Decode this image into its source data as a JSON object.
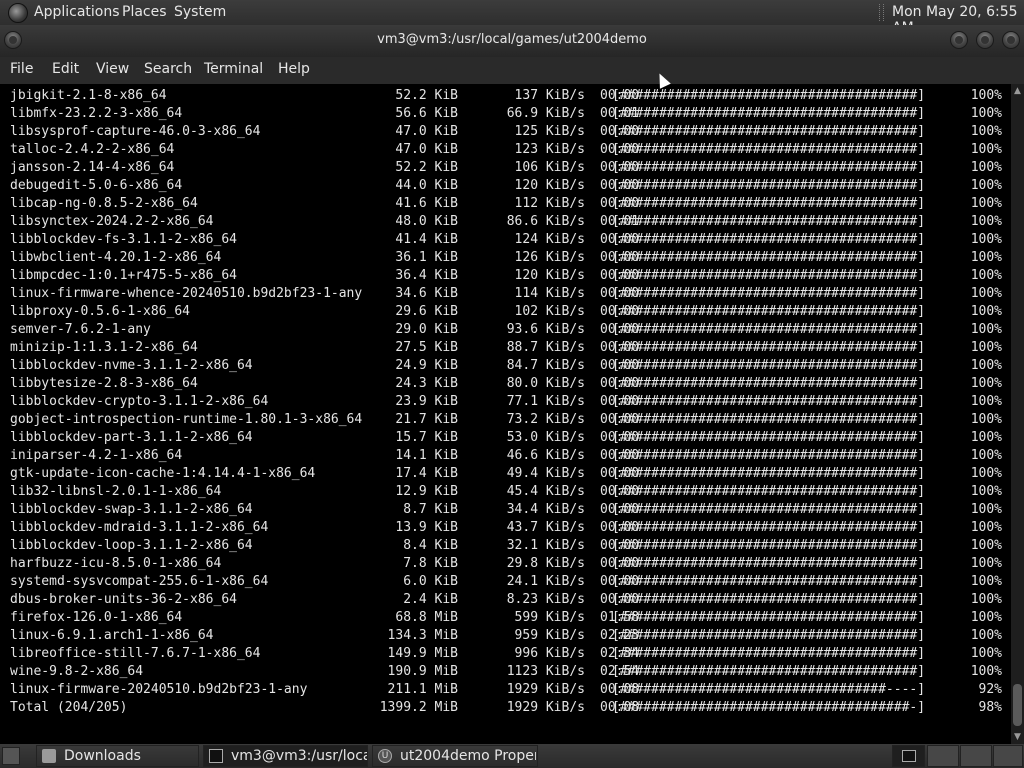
{
  "top_panel": {
    "menus": [
      "Applications",
      "Places",
      "System"
    ],
    "clock": "Mon May 20,  6:55 AM"
  },
  "window": {
    "title": "vm3@vm3:/usr/local/games/ut2004demo"
  },
  "menubar": [
    "File",
    "Edit",
    "View",
    "Search",
    "Terminal",
    "Help"
  ],
  "terminal": {
    "lines": [
      {
        "name": "jbigkit-2.1-8-x86_64",
        "size": "52.2 KiB",
        "rate": "137 KiB/s",
        "eta": "00:00",
        "bar": "[######################################]",
        "pct": "100%"
      },
      {
        "name": "libmfx-23.2.2-3-x86_64",
        "size": "56.6 KiB",
        "rate": "66.9 KiB/s",
        "eta": "00:01",
        "bar": "[######################################]",
        "pct": "100%"
      },
      {
        "name": "libsysprof-capture-46.0-3-x86_64",
        "size": "47.0 KiB",
        "rate": "125 KiB/s",
        "eta": "00:00",
        "bar": "[######################################]",
        "pct": "100%"
      },
      {
        "name": "talloc-2.4.2-2-x86_64",
        "size": "47.0 KiB",
        "rate": "123 KiB/s",
        "eta": "00:00",
        "bar": "[######################################]",
        "pct": "100%"
      },
      {
        "name": "jansson-2.14-4-x86_64",
        "size": "52.2 KiB",
        "rate": "106 KiB/s",
        "eta": "00:00",
        "bar": "[######################################]",
        "pct": "100%"
      },
      {
        "name": "debugedit-5.0-6-x86_64",
        "size": "44.0 KiB",
        "rate": "120 KiB/s",
        "eta": "00:00",
        "bar": "[######################################]",
        "pct": "100%"
      },
      {
        "name": "libcap-ng-0.8.5-2-x86_64",
        "size": "41.6 KiB",
        "rate": "112 KiB/s",
        "eta": "00:00",
        "bar": "[######################################]",
        "pct": "100%"
      },
      {
        "name": "libsynctex-2024.2-2-x86_64",
        "size": "48.0 KiB",
        "rate": "86.6 KiB/s",
        "eta": "00:01",
        "bar": "[######################################]",
        "pct": "100%"
      },
      {
        "name": "libblockdev-fs-3.1.1-2-x86_64",
        "size": "41.4 KiB",
        "rate": "124 KiB/s",
        "eta": "00:00",
        "bar": "[######################################]",
        "pct": "100%"
      },
      {
        "name": "libwbclient-4.20.1-2-x86_64",
        "size": "36.1 KiB",
        "rate": "126 KiB/s",
        "eta": "00:00",
        "bar": "[######################################]",
        "pct": "100%"
      },
      {
        "name": "libmpcdec-1:0.1+r475-5-x86_64",
        "size": "36.4 KiB",
        "rate": "120 KiB/s",
        "eta": "00:00",
        "bar": "[######################################]",
        "pct": "100%"
      },
      {
        "name": "linux-firmware-whence-20240510.b9d2bf23-1-any",
        "size": "34.6 KiB",
        "rate": "114 KiB/s",
        "eta": "00:00",
        "bar": "[######################################]",
        "pct": "100%"
      },
      {
        "name": "libproxy-0.5.6-1-x86_64",
        "size": "29.6 KiB",
        "rate": "102 KiB/s",
        "eta": "00:00",
        "bar": "[######################################]",
        "pct": "100%"
      },
      {
        "name": "semver-7.6.2-1-any",
        "size": "29.0 KiB",
        "rate": "93.6 KiB/s",
        "eta": "00:00",
        "bar": "[######################################]",
        "pct": "100%"
      },
      {
        "name": "minizip-1:1.3.1-2-x86_64",
        "size": "27.5 KiB",
        "rate": "88.7 KiB/s",
        "eta": "00:00",
        "bar": "[######################################]",
        "pct": "100%"
      },
      {
        "name": "libblockdev-nvme-3.1.1-2-x86_64",
        "size": "24.9 KiB",
        "rate": "84.7 KiB/s",
        "eta": "00:00",
        "bar": "[######################################]",
        "pct": "100%"
      },
      {
        "name": "libbytesize-2.8-3-x86_64",
        "size": "24.3 KiB",
        "rate": "80.0 KiB/s",
        "eta": "00:00",
        "bar": "[######################################]",
        "pct": "100%"
      },
      {
        "name": "libblockdev-crypto-3.1.1-2-x86_64",
        "size": "23.9 KiB",
        "rate": "77.1 KiB/s",
        "eta": "00:00",
        "bar": "[######################################]",
        "pct": "100%"
      },
      {
        "name": "gobject-introspection-runtime-1.80.1-3-x86_64",
        "size": "21.7 KiB",
        "rate": "73.2 KiB/s",
        "eta": "00:00",
        "bar": "[######################################]",
        "pct": "100%"
      },
      {
        "name": "libblockdev-part-3.1.1-2-x86_64",
        "size": "15.7 KiB",
        "rate": "53.0 KiB/s",
        "eta": "00:00",
        "bar": "[######################################]",
        "pct": "100%"
      },
      {
        "name": "iniparser-4.2-1-x86_64",
        "size": "14.1 KiB",
        "rate": "46.6 KiB/s",
        "eta": "00:00",
        "bar": "[######################################]",
        "pct": "100%"
      },
      {
        "name": "gtk-update-icon-cache-1:4.14.4-1-x86_64",
        "size": "17.4 KiB",
        "rate": "49.4 KiB/s",
        "eta": "00:00",
        "bar": "[######################################]",
        "pct": "100%"
      },
      {
        "name": "lib32-libnsl-2.0.1-1-x86_64",
        "size": "12.9 KiB",
        "rate": "45.4 KiB/s",
        "eta": "00:00",
        "bar": "[######################################]",
        "pct": "100%"
      },
      {
        "name": "libblockdev-swap-3.1.1-2-x86_64",
        "size": "8.7 KiB",
        "rate": "34.4 KiB/s",
        "eta": "00:00",
        "bar": "[######################################]",
        "pct": "100%"
      },
      {
        "name": "libblockdev-mdraid-3.1.1-2-x86_64",
        "size": "13.9 KiB",
        "rate": "43.7 KiB/s",
        "eta": "00:00",
        "bar": "[######################################]",
        "pct": "100%"
      },
      {
        "name": "libblockdev-loop-3.1.1-2-x86_64",
        "size": "8.4 KiB",
        "rate": "32.1 KiB/s",
        "eta": "00:00",
        "bar": "[######################################]",
        "pct": "100%"
      },
      {
        "name": "harfbuzz-icu-8.5.0-1-x86_64",
        "size": "7.8 KiB",
        "rate": "29.8 KiB/s",
        "eta": "00:00",
        "bar": "[######################################]",
        "pct": "100%"
      },
      {
        "name": "systemd-sysvcompat-255.6-1-x86_64",
        "size": "6.0 KiB",
        "rate": "24.1 KiB/s",
        "eta": "00:00",
        "bar": "[######################################]",
        "pct": "100%"
      },
      {
        "name": "dbus-broker-units-36-2-x86_64",
        "size": "2.4 KiB",
        "rate": "8.23 KiB/s",
        "eta": "00:00",
        "bar": "[######################################]",
        "pct": "100%"
      },
      {
        "name": "firefox-126.0-1-x86_64",
        "size": "68.8 MiB",
        "rate": "599 KiB/s",
        "eta": "01:58",
        "bar": "[######################################]",
        "pct": "100%"
      },
      {
        "name": "linux-6.9.1.arch1-1-x86_64",
        "size": "134.3 MiB",
        "rate": "959 KiB/s",
        "eta": "02:23",
        "bar": "[######################################]",
        "pct": "100%"
      },
      {
        "name": "libreoffice-still-7.6.7-1-x86_64",
        "size": "149.9 MiB",
        "rate": "996 KiB/s",
        "eta": "02:34",
        "bar": "[######################################]",
        "pct": "100%"
      },
      {
        "name": "wine-9.8-2-x86_64",
        "size": "190.9 MiB",
        "rate": "1123 KiB/s",
        "eta": "02:54",
        "bar": "[######################################]",
        "pct": "100%"
      },
      {
        "name": "linux-firmware-20240510.b9d2bf23-1-any",
        "size": "211.1 MiB",
        "rate": "1929 KiB/s",
        "eta": "00:08",
        "bar": "[##################################----]",
        "pct": "92%"
      },
      {
        "name": "Total (204/205)",
        "size": "1399.2 MiB",
        "rate": "1929 KiB/s",
        "eta": "00:08",
        "bar": "[#####################################-]",
        "pct": "98%"
      }
    ]
  },
  "taskbar": {
    "items": [
      {
        "label": "Downloads",
        "icon": "folder-icon"
      },
      {
        "label": "vm3@vm3:/usr/loca...",
        "icon": "terminal-icon"
      },
      {
        "label": "ut2004demo Proper...",
        "icon": "ut2004-icon"
      }
    ]
  },
  "colors": {
    "terminal_bg": "#000000",
    "terminal_fg": "#e5e5e5",
    "panel_bg": "#2e2e2e"
  }
}
